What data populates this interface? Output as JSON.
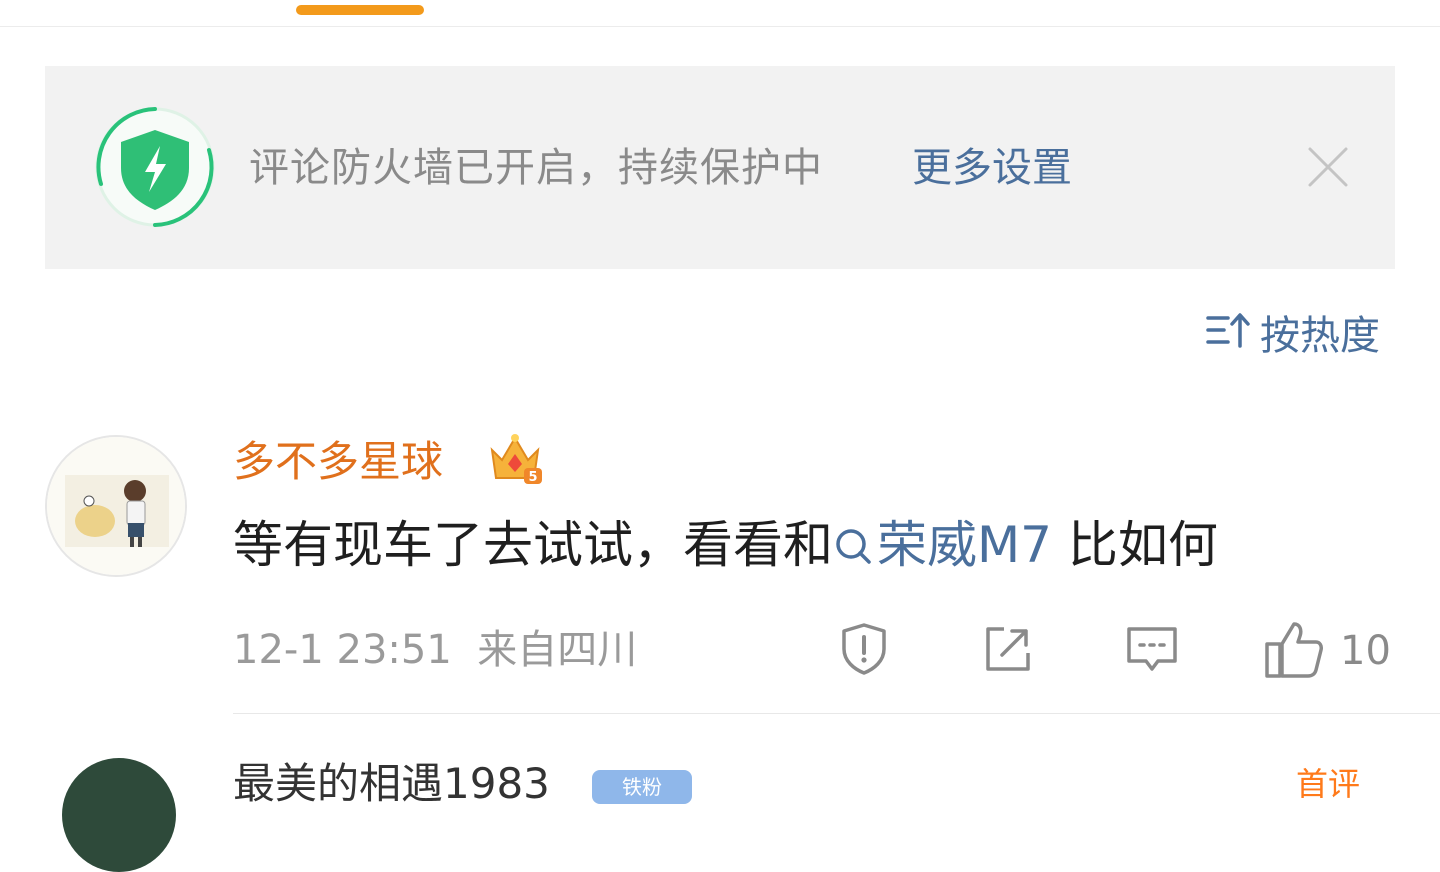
{
  "firewall": {
    "message": "评论防火墙已开启，持续保护中",
    "settings_link": "更多设置"
  },
  "sort": {
    "label": "按热度"
  },
  "comment": {
    "username": "多不多星球",
    "text_before": "等有现车了去试试，看看和",
    "topic": "荣威M7",
    "text_after": " 比如何",
    "time": "12-1 23:51",
    "location": "来自四川",
    "like_count": "10"
  },
  "next_comment": {
    "username": "最美的相遇1983",
    "fan_badge": "铁粉",
    "top_badge": "首评"
  },
  "colors": {
    "accent_orange": "#f39a1b",
    "username_orange": "#e0701c",
    "link_blue": "#4a6f9c",
    "shield_green": "#29c27a"
  }
}
